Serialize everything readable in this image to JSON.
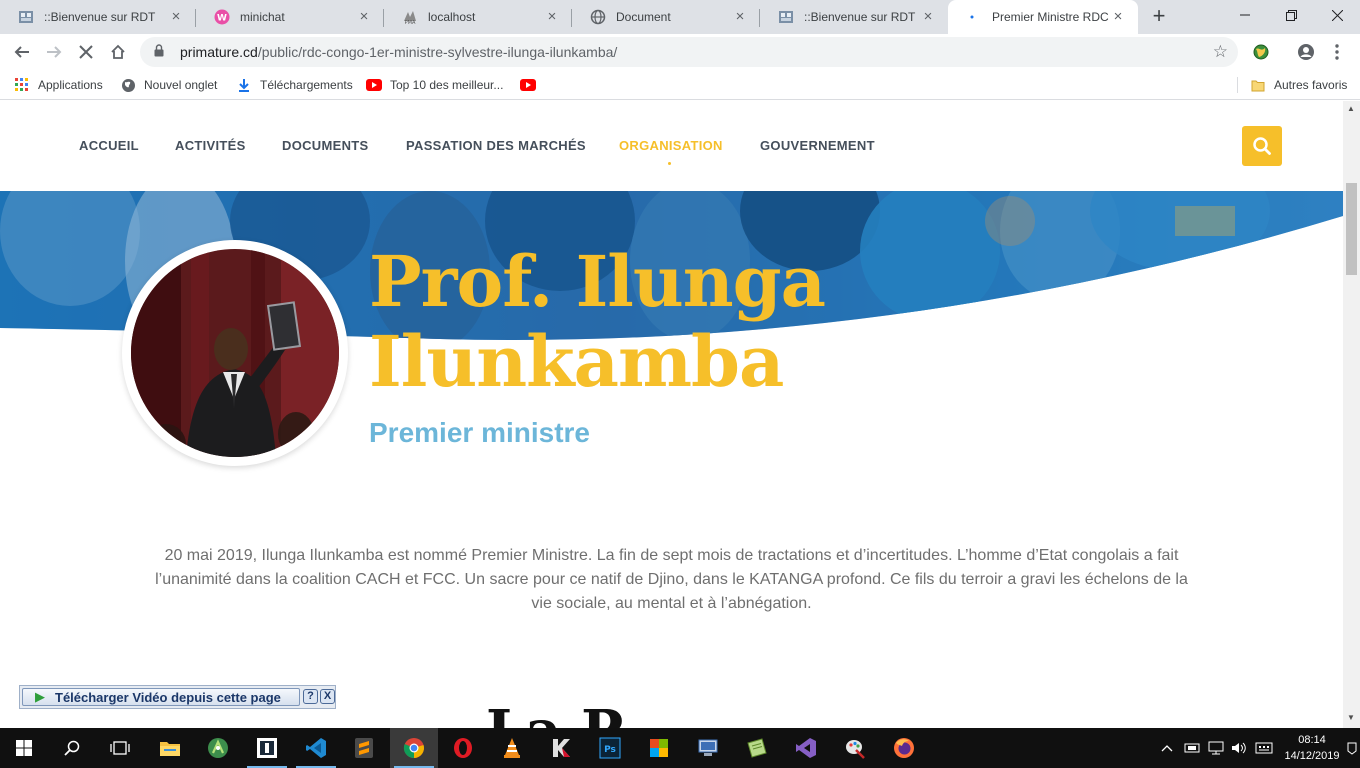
{
  "browser": {
    "tabs": [
      {
        "title": "::Bienvenue sur RDT",
        "favicon": "rdt-favicon"
      },
      {
        "title": "minichat",
        "favicon": "wamp-favicon"
      },
      {
        "title": "localhost",
        "favicon": "phpmyadmin-favicon"
      },
      {
        "title": "Document",
        "favicon": "globe-icon"
      },
      {
        "title": "::Bienvenue sur RDT",
        "favicon": "rdt-favicon"
      },
      {
        "title": "Premier Ministre RDC -",
        "favicon": "loading-dot-icon",
        "active": true
      }
    ],
    "url_host": "primature.cd",
    "url_path": "/public/rdc-congo-1er-ministre-sylvestre-ilunga-ilunkamba/",
    "bookmarks": [
      {
        "label": "Applications",
        "icon": "apps-grid-icon"
      },
      {
        "label": "Nouvel onglet",
        "icon": "globe-icon"
      },
      {
        "label": "Téléchargements",
        "icon": "download-icon"
      },
      {
        "label": "Top 10 des meilleur...",
        "icon": "youtube-icon"
      },
      {
        "label": "",
        "icon": "youtube-icon"
      }
    ],
    "other_bookmarks": "Autres favoris"
  },
  "site": {
    "nav": [
      {
        "label": "ACCUEIL"
      },
      {
        "label": "ACTIVITÉS"
      },
      {
        "label": "DOCUMENTS"
      },
      {
        "label": "PASSATION DES MARCHÉS"
      },
      {
        "label": "ORGANISATION",
        "active": true
      },
      {
        "label": "GOUVERNEMENT"
      }
    ],
    "accent_color": "#f6bf2a",
    "role_color": "#6cb6d9",
    "hero": {
      "name_line1": "Prof. Ilunga",
      "name_line2": "Ilunkamba",
      "role": "Premier ministre"
    },
    "intro": "20 mai 2019, Ilunga Ilunkamba est nommé Premier Ministre. La fin de sept mois de tractations et d’incertitudes. L’homme d’Etat congolais a fait l’unanimité dans la coalition CACH et FCC. Un sacre pour ce natif de Djino, dans le KATANGA profond. Ce fils du terroir a gravi les échelons de la vie sociale, au mental et à l’abnégation.",
    "next_heading_partial": "La P"
  },
  "video_bar": {
    "label": "Télécharger Vidéo depuis cette page",
    "help": "?",
    "close": "X"
  },
  "taskbar": {
    "apps": [
      "file-explorer-icon",
      "android-studio-icon",
      "sublime-like-icon",
      "vscode-icon",
      "sublime-text-icon",
      "chrome-icon",
      "opera-icon",
      "vlc-icon",
      "kaspersky-icon",
      "photoshop-icon",
      "office-icon",
      "remote-desktop-icon",
      "notepad-icon",
      "visual-studio-icon",
      "paint-icon",
      "firefox-icon"
    ],
    "time": "08:14",
    "date": "14/12/2019"
  }
}
